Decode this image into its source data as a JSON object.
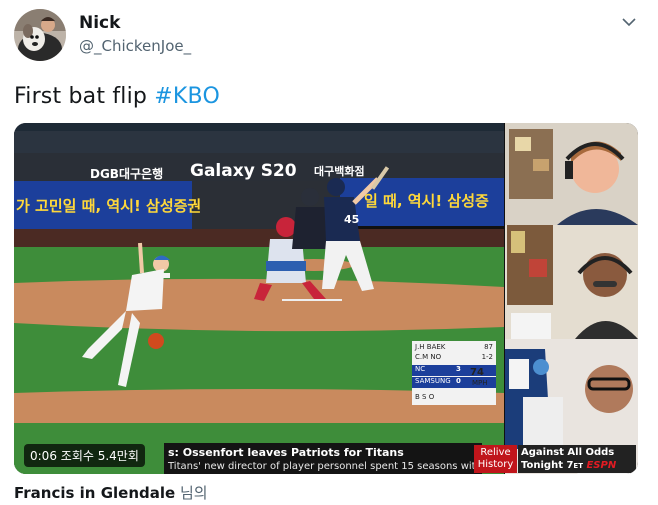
{
  "author": {
    "name": "Nick",
    "handle": "@_ChickenJoe_"
  },
  "tweet": {
    "text_prefix": "First bat flip ",
    "hashtag": "#KBO"
  },
  "video": {
    "ads": {
      "bank": "DGB대구은행",
      "bank_logo": "DGB",
      "galaxy": "Galaxy S20",
      "dept_store": "대구백화점",
      "left_banner": "가 고민일 때, 역시! 삼성증권",
      "right_banner": "일 때, 역시! 삼성증",
      "player_num": "45"
    },
    "scorebug": {
      "pitcher": "J.H BAEK",
      "pitcher_pitches": "87",
      "batter": "C.M NO",
      "batter_line": "1-2",
      "team1": "NC",
      "score1": "3",
      "team2": "SAMSUNG",
      "score2": "0",
      "speed": "74",
      "speed_unit": "MPH",
      "count": "B S O"
    },
    "time": "0:06",
    "views": "조회수 5.4만회",
    "ticker_headline": "s: Ossenfort leaves Patriots for Titans",
    "ticker_sub": "Titans' new director of player personnel spent 15 seasons with Pats",
    "relive_line1": "Relive",
    "relive_line2": "History",
    "promo_line1": "Against All Odds",
    "promo_line2": "Tonight 7",
    "promo_et": "ET",
    "network": "ESPN"
  },
  "footer": {
    "name": "Francis in Glendale",
    "suffix": " 님의"
  },
  "colors": {
    "link": "#1b95e0",
    "banner_blue": "#1c3f9b",
    "field_green": "#3e8d3a",
    "dirt": "#c98a5e",
    "espn_red": "#e21b23"
  },
  "icons": {
    "menu": "chevron-down-icon",
    "avatar": "dog-avatar"
  }
}
